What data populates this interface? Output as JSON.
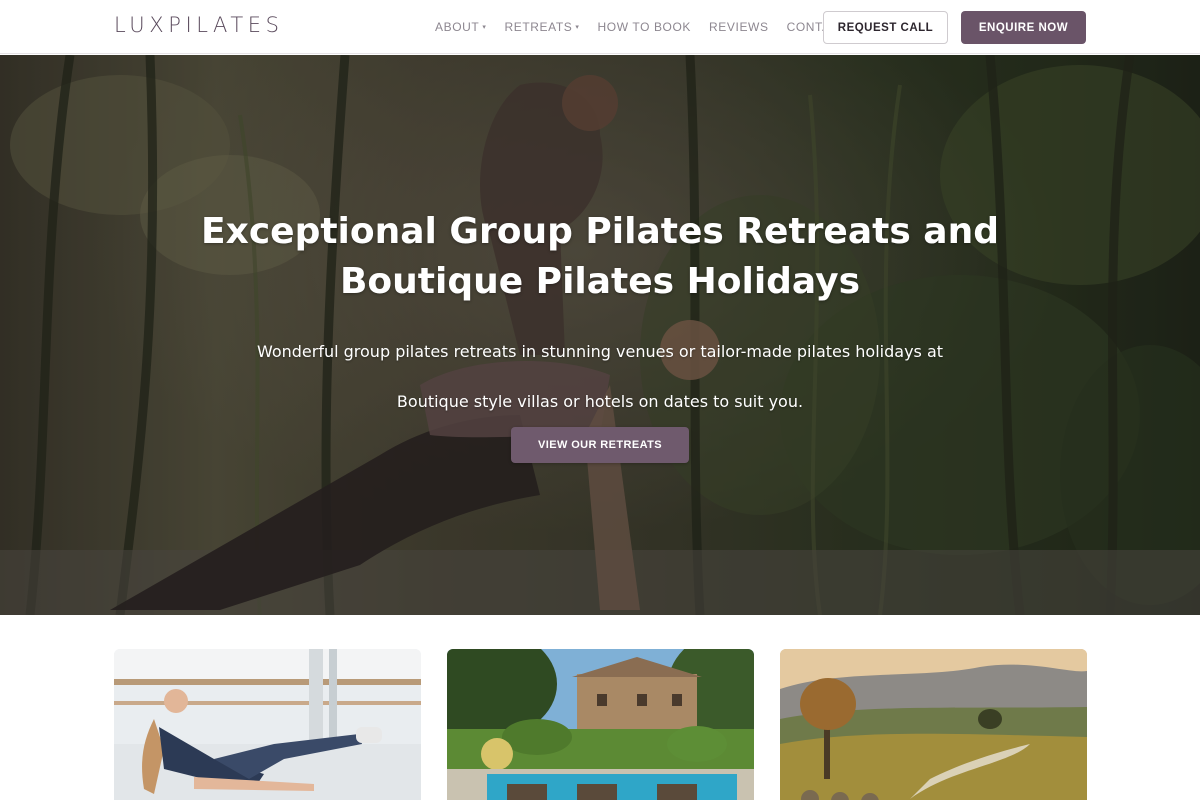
{
  "brand": {
    "name": "LUXPILATES"
  },
  "nav": {
    "items": [
      {
        "label": "ABOUT",
        "dropdown": true
      },
      {
        "label": "RETREATS",
        "dropdown": true
      },
      {
        "label": "HOW TO BOOK",
        "dropdown": false
      },
      {
        "label": "REVIEWS",
        "dropdown": false
      },
      {
        "label": "CONTACT",
        "dropdown": false
      }
    ],
    "caret_glyph": "▾"
  },
  "header_buttons": {
    "request_label": "REQUEST CALL",
    "enquire_label": "ENQUIRE NOW"
  },
  "hero": {
    "title_line1": "Exceptional Group Pilates Retreats and",
    "title_line2": "Boutique Pilates Holidays",
    "subtitle_line1": "Wonderful group pilates retreats in stunning venues or tailor-made pilates holidays at",
    "subtitle_line2": "Boutique style villas or hotels on dates to suit you.",
    "cta_label": "VIEW OUR RETREATS"
  },
  "cards": [
    {
      "image": "pilates-studio-photo"
    },
    {
      "image": "villa-pool-photo"
    },
    {
      "image": "countryside-landscape-photo"
    }
  ],
  "colors": {
    "brand_purple": "#6a5468",
    "nav_text": "#8d8790",
    "logo_text": "#5a4a5c"
  }
}
